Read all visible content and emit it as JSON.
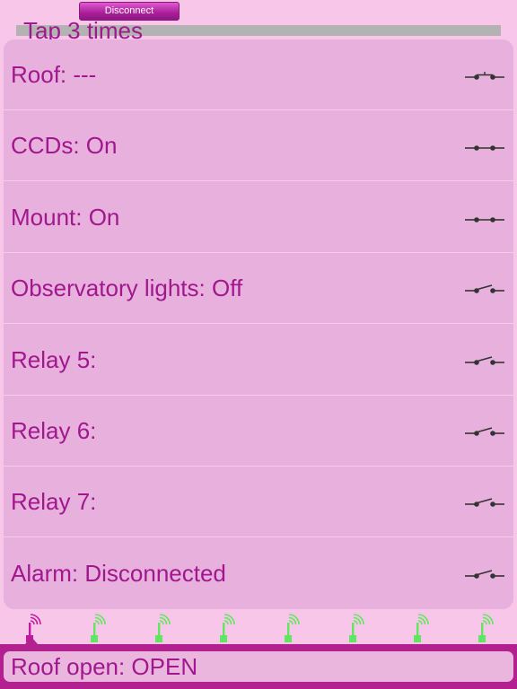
{
  "header": {
    "disconnect_label": "Disconnect",
    "tap_hint": "Tap 3 times"
  },
  "relays": [
    {
      "label": "Roof: ---",
      "state": "unknown"
    },
    {
      "label": "CCDs: On",
      "state": "closed"
    },
    {
      "label": "Mount: On",
      "state": "closed"
    },
    {
      "label": "Observatory lights: Off",
      "state": "open"
    },
    {
      "label": "Relay 5:",
      "state": "open"
    },
    {
      "label": "Relay 6:",
      "state": "open"
    },
    {
      "label": "Relay 7:",
      "state": "open"
    },
    {
      "label": "Alarm: Disconnected",
      "state": "open"
    }
  ],
  "antennas": [
    {
      "color": "#c2189e",
      "selected": true
    },
    {
      "color": "#5fe85f",
      "selected": false
    },
    {
      "color": "#5fe85f",
      "selected": false
    },
    {
      "color": "#5fe85f",
      "selected": false
    },
    {
      "color": "#5fe85f",
      "selected": false
    },
    {
      "color": "#5fe85f",
      "selected": false
    },
    {
      "color": "#5fe85f",
      "selected": false
    },
    {
      "color": "#5fe85f",
      "selected": false
    }
  ],
  "status": {
    "text": "Roof open: OPEN"
  },
  "colors": {
    "accent": "#a0178e",
    "background": "#f7c6e8",
    "panel": "#e8b0dc",
    "status_bar": "#b3208f"
  }
}
